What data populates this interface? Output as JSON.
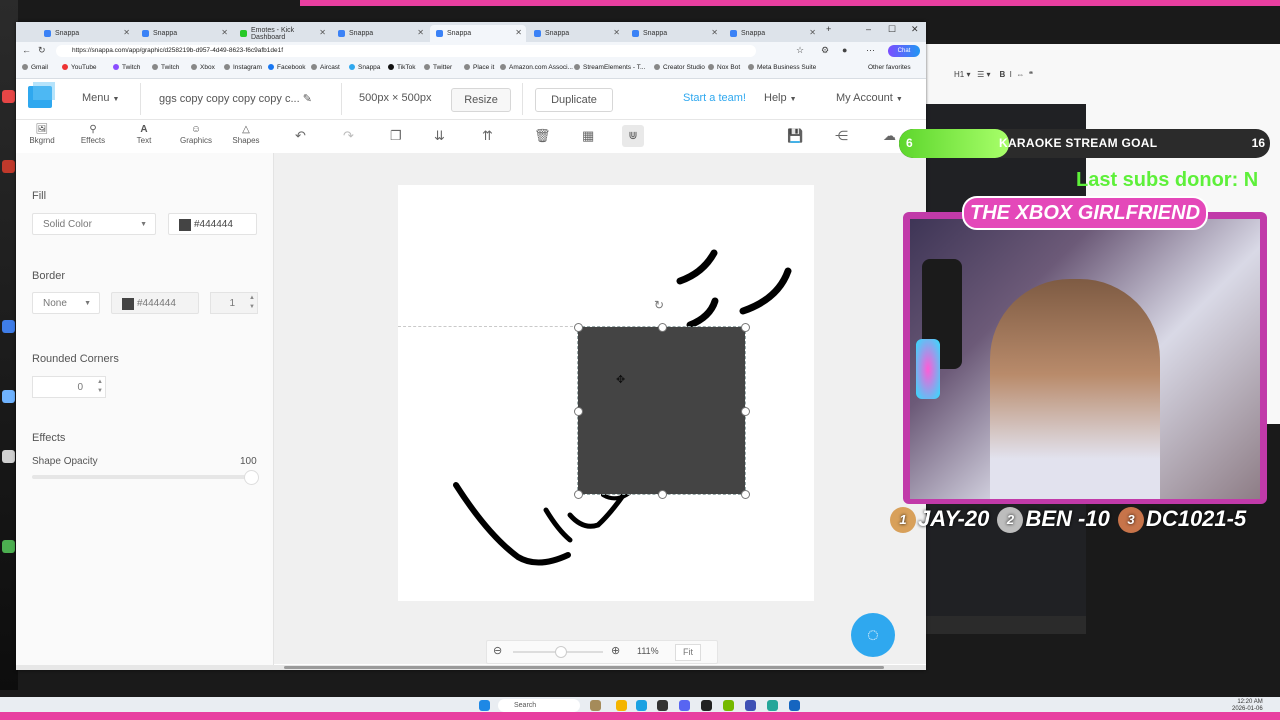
{
  "browser": {
    "tabs": [
      {
        "label": "Snappa",
        "active": false
      },
      {
        "label": "Snappa",
        "active": false
      },
      {
        "label": "Emotes - Kick Dashboard",
        "active": false
      },
      {
        "label": "Snappa",
        "active": false
      },
      {
        "label": "Snappa",
        "active": false
      },
      {
        "label": "Snappa",
        "active": false
      },
      {
        "label": "Snappa",
        "active": false
      },
      {
        "label": "Snappa",
        "active": true
      }
    ],
    "url": "https://snappa.com/app/graphic/d258219b-d957-4d49-8623-f6c9afb1de1f",
    "ai_button": "Chat",
    "bookmarks": [
      "Gmail",
      "YouTube",
      "Twitch",
      "Twitch",
      "Xbox",
      "Instagram",
      "Facebook",
      "Aircast",
      "Snappa",
      "TikTok",
      "Twitter",
      "Place it",
      "Amazon.com Associ...",
      "StreamElements - T...",
      "Creator Studio",
      "Nox Bot",
      "Meta Business Suite"
    ],
    "other_favorites": "Other favorites"
  },
  "app": {
    "menu_label": "Menu",
    "doc_title": "ggs copy copy copy copy c...",
    "dimensions": "500px × 500px",
    "resize_label": "Resize",
    "duplicate_label": "Duplicate",
    "start_team": "Start a team!",
    "help_label": "Help",
    "account_label": "My Account",
    "tools": [
      {
        "label": "Bkgrnd",
        "icon": "image-icon"
      },
      {
        "label": "Effects",
        "icon": "wand-icon"
      },
      {
        "label": "Text",
        "icon": "text-icon"
      },
      {
        "label": "Graphics",
        "icon": "smiley-icon"
      },
      {
        "label": "Shapes",
        "icon": "triangle-icon"
      }
    ],
    "accent_color": "#2fa8ef"
  },
  "panel": {
    "fill_label": "Fill",
    "fill_type": "Solid Color",
    "fill_color": "#444444",
    "border_label": "Border",
    "border_type": "None",
    "border_color": "#444444",
    "border_width": "1",
    "rounded_label": "Rounded Corners",
    "rounded_value": "0",
    "effects_label": "Effects",
    "opacity_label": "Shape Opacity",
    "opacity_value": "100",
    "opacity_fraction": 1.0
  },
  "canvas": {
    "zoom": "111%",
    "fit_label": "Fit",
    "shape_color": "#444444"
  },
  "overlay": {
    "goal_current": "6",
    "goal_label": "KARAOKE STREAM GOAL",
    "goal_target": "16",
    "donor_text": "Last subs donor: N",
    "cam_title": "THE XBOX GIRLFRIEND",
    "ranks": [
      {
        "medal": "1",
        "text": "JAY-20"
      },
      {
        "medal": "2",
        "text": "BEN -10"
      },
      {
        "medal": "3",
        "text": "DC1021-5"
      }
    ]
  },
  "taskbar": {
    "search_label": "Search",
    "time": "12:20 AM",
    "date": "2026-01-06"
  }
}
